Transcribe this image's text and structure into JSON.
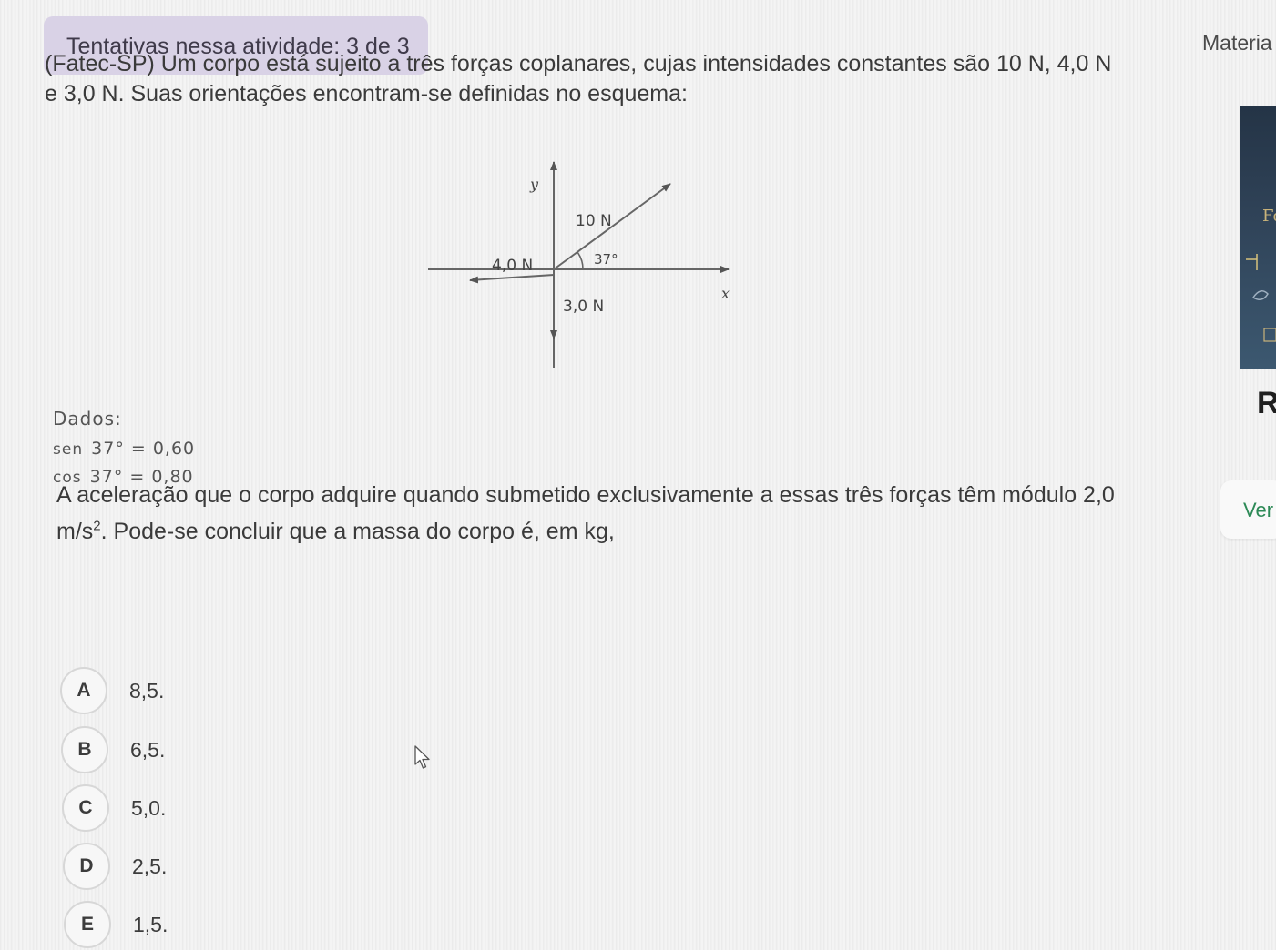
{
  "header": {
    "attempts_label": "Tentativas nessa atividade: 3 de 3",
    "side_header": "Materia"
  },
  "question": {
    "statement_line1": "(Fatec-SP) Um corpo está sujeito a três forças coplanares, cujas intensidades constantes são 10 N, 4,0 N",
    "statement_line2": "e 3,0 N. Suas orientações encontram-se definidas no esquema:"
  },
  "diagram": {
    "y_axis_label": "y",
    "x_axis_label": "x",
    "force_diagonal_label": "10 N",
    "force_left_label": "4,0 N",
    "force_down_label": "3,0 N",
    "angle_label": "37°"
  },
  "given": {
    "title": "Dados:",
    "sen_fn": "sen",
    "sen_expr": "37° = 0,60",
    "cos_fn": "cos",
    "cos_expr": "37° = 0,80"
  },
  "prompt": {
    "line1": "A aceleração que o corpo adquire quando submetido exclusivamente a essas três forças têm módulo 2,0",
    "unit_base": "m/s",
    "unit_exp": "2",
    "line2_rest": ". Pode-se concluir que a massa do corpo é, em kg,"
  },
  "options": [
    {
      "letter": "A",
      "text": "8,5."
    },
    {
      "letter": "B",
      "text": "6,5."
    },
    {
      "letter": "C",
      "text": "5,0."
    },
    {
      "letter": "D",
      "text": "2,5."
    },
    {
      "letter": "E",
      "text": "1,5."
    }
  ],
  "side_panel": {
    "panel_text_1": "Fo",
    "panel_text_2": "R",
    "button_label": "Ver"
  },
  "icons": {
    "cursor": "mouse-pointer-icon"
  }
}
